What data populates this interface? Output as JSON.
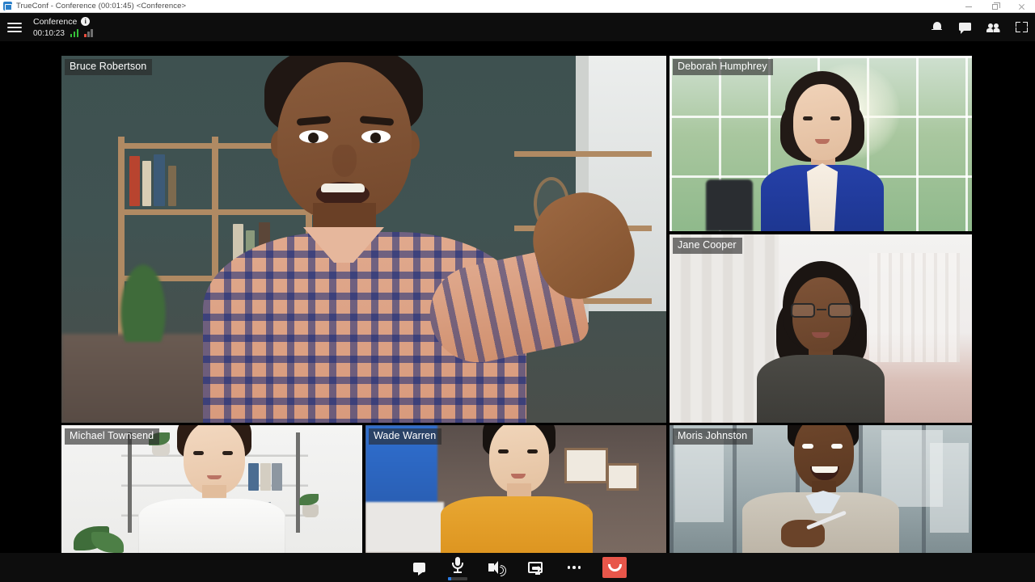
{
  "window": {
    "title": "TrueConf - Conference (00:01:45) <Conference>",
    "app_icon": "trueconf-logo-icon",
    "controls": {
      "minimize": "minimize-button",
      "maximize": "maximize-button",
      "close": "close-button"
    }
  },
  "header": {
    "menu_icon": "hamburger-menu-icon",
    "conference_name": "Conference",
    "info_icon": "info-icon",
    "timer": "00:10:23",
    "signal_good_label": "network-signal-good",
    "signal_bad_label": "network-signal-poor",
    "actions": [
      {
        "name": "notifications-button",
        "icon": "bell-icon"
      },
      {
        "name": "chat-button",
        "icon": "chat-bubble-icon"
      },
      {
        "name": "participants-button",
        "icon": "people-icon"
      },
      {
        "name": "fullscreen-button",
        "icon": "fullscreen-icon"
      }
    ]
  },
  "participants": [
    {
      "name": "Bruce Robertson",
      "position": "main-large"
    },
    {
      "name": "Deborah Humphrey",
      "position": "right-top"
    },
    {
      "name": "Jane Cooper",
      "position": "right-middle"
    },
    {
      "name": "Michael Townsend",
      "position": "bottom-left"
    },
    {
      "name": "Wade Warren",
      "position": "bottom-center"
    },
    {
      "name": "Moris Johnston",
      "position": "bottom-right"
    }
  ],
  "toolbar": {
    "buttons": [
      {
        "name": "camera-toggle-button",
        "icon": "video-camera-icon"
      },
      {
        "name": "microphone-toggle-button",
        "icon": "microphone-icon"
      },
      {
        "name": "speaker-button",
        "icon": "speaker-icon"
      },
      {
        "name": "screen-share-button",
        "icon": "screen-share-icon"
      },
      {
        "name": "more-options-button",
        "icon": "ellipsis-icon"
      },
      {
        "name": "hangup-button",
        "icon": "phone-hangup-icon"
      }
    ],
    "mic_level_percent": 15,
    "hangup_color": "#e8564a",
    "mic_level_color": "#2a7ae2"
  },
  "colors": {
    "chrome_background": "#0d0d0d",
    "titlebar_background": "#ffffff",
    "name_label_background": "rgba(40,40,40,0.62)",
    "signal_good": "#35c23a",
    "signal_bad": "#e84d3d"
  }
}
